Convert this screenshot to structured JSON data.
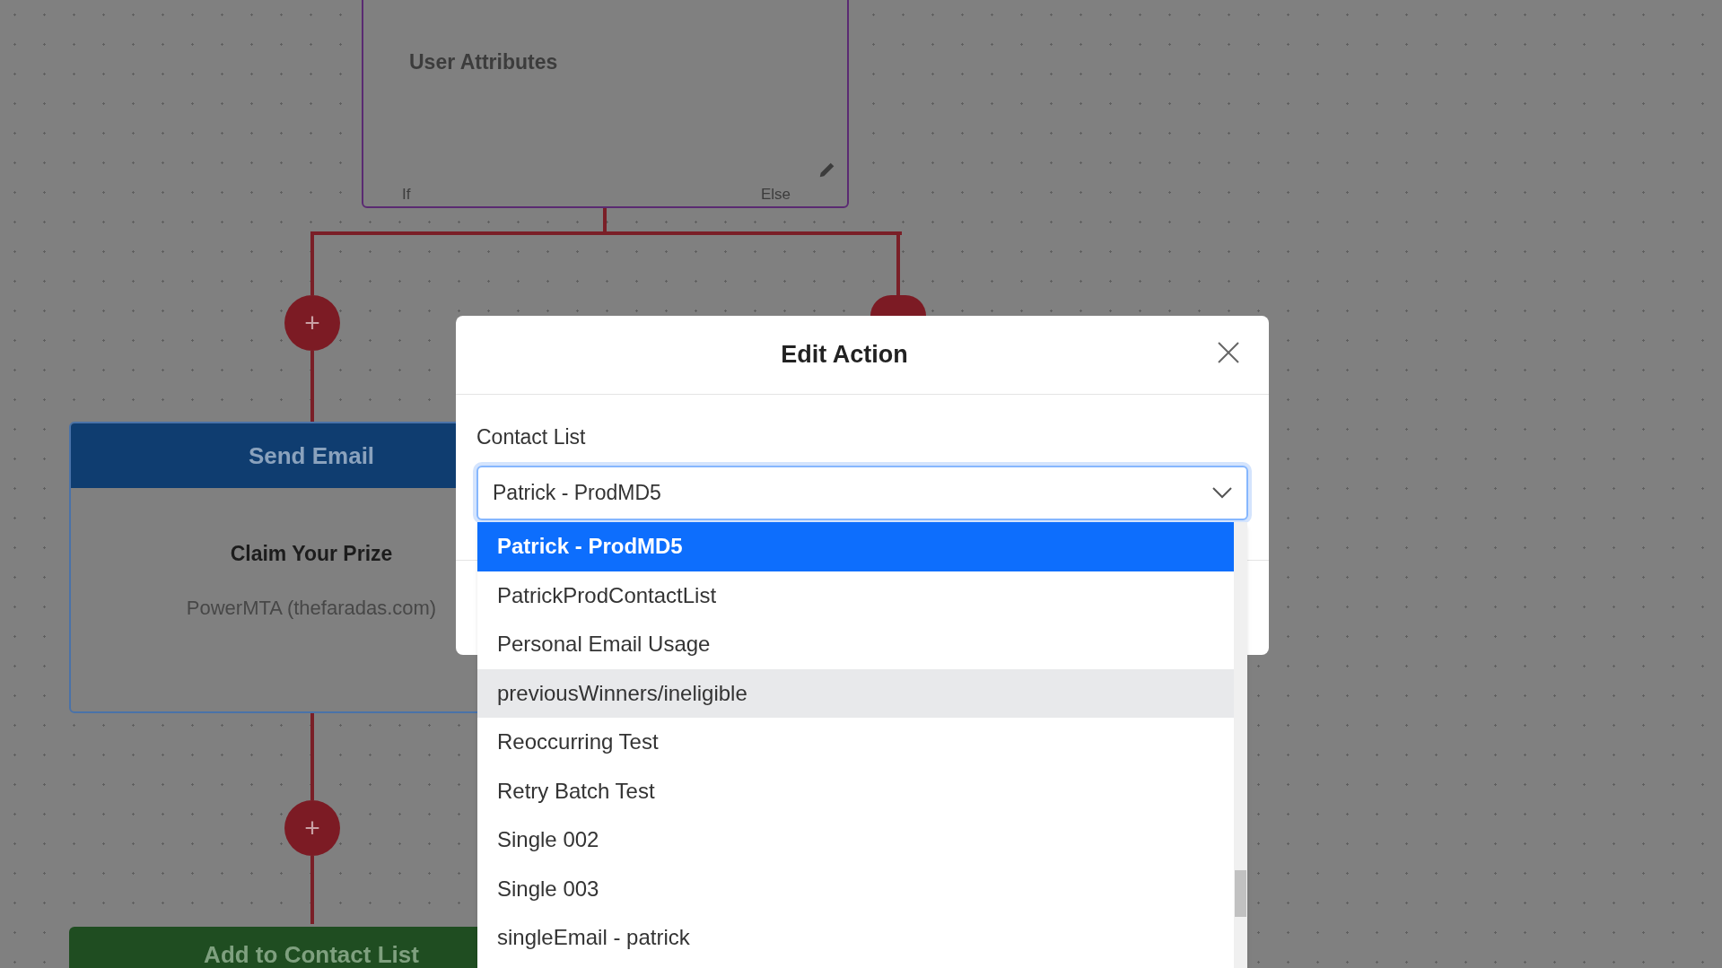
{
  "canvas": {
    "nodes": [
      {
        "kind": "condition",
        "title": "User Attributes",
        "branches": [
          "If",
          "Else"
        ]
      },
      {
        "kind": "email",
        "header": "Send Email",
        "subject": "Claim Your Prize",
        "sender": "PowerMTA (thefaradas.com)"
      },
      {
        "kind": "contact_list",
        "header": "Add to Contact List"
      }
    ],
    "add_buttons": [
      "+",
      "+"
    ]
  },
  "modal": {
    "title": "Edit Action",
    "field": {
      "label": "Contact List",
      "value": "Patrick - ProdMD5",
      "expanded": true
    },
    "options": [
      {
        "label": "Patrick - ProdMD5",
        "selected": true,
        "hovered": false
      },
      {
        "label": "PatrickProdContactList",
        "selected": false,
        "hovered": false
      },
      {
        "label": "Personal Email Usage",
        "selected": false,
        "hovered": false
      },
      {
        "label": "previousWinners/ineligible",
        "selected": false,
        "hovered": true
      },
      {
        "label": "Reoccurring Test",
        "selected": false,
        "hovered": false
      },
      {
        "label": "Retry Batch Test",
        "selected": false,
        "hovered": false
      },
      {
        "label": "Single 002",
        "selected": false,
        "hovered": false
      },
      {
        "label": "Single 003",
        "selected": false,
        "hovered": false
      },
      {
        "label": "singleEmail - patrick",
        "selected": false,
        "hovered": false
      }
    ]
  }
}
